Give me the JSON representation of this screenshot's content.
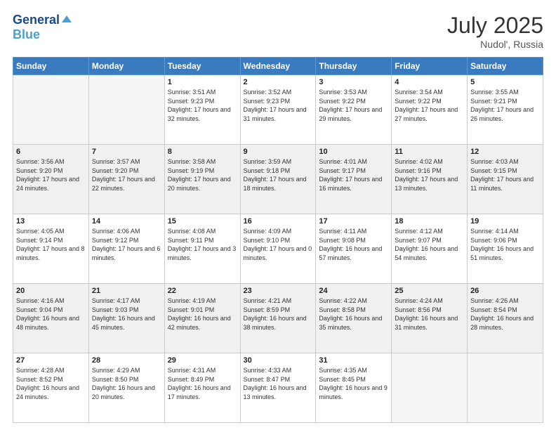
{
  "header": {
    "logo_line1": "General",
    "logo_line2": "Blue",
    "month_year": "July 2025",
    "location": "Nudol', Russia"
  },
  "days_of_week": [
    "Sunday",
    "Monday",
    "Tuesday",
    "Wednesday",
    "Thursday",
    "Friday",
    "Saturday"
  ],
  "weeks": [
    [
      {
        "day": "",
        "sunrise": "",
        "sunset": "",
        "daylight": "",
        "empty": true
      },
      {
        "day": "",
        "sunrise": "",
        "sunset": "",
        "daylight": "",
        "empty": true
      },
      {
        "day": "1",
        "sunrise": "Sunrise: 3:51 AM",
        "sunset": "Sunset: 9:23 PM",
        "daylight": "Daylight: 17 hours and 32 minutes.",
        "empty": false
      },
      {
        "day": "2",
        "sunrise": "Sunrise: 3:52 AM",
        "sunset": "Sunset: 9:23 PM",
        "daylight": "Daylight: 17 hours and 31 minutes.",
        "empty": false
      },
      {
        "day": "3",
        "sunrise": "Sunrise: 3:53 AM",
        "sunset": "Sunset: 9:22 PM",
        "daylight": "Daylight: 17 hours and 29 minutes.",
        "empty": false
      },
      {
        "day": "4",
        "sunrise": "Sunrise: 3:54 AM",
        "sunset": "Sunset: 9:22 PM",
        "daylight": "Daylight: 17 hours and 27 minutes.",
        "empty": false
      },
      {
        "day": "5",
        "sunrise": "Sunrise: 3:55 AM",
        "sunset": "Sunset: 9:21 PM",
        "daylight": "Daylight: 17 hours and 26 minutes.",
        "empty": false
      }
    ],
    [
      {
        "day": "6",
        "sunrise": "Sunrise: 3:56 AM",
        "sunset": "Sunset: 9:20 PM",
        "daylight": "Daylight: 17 hours and 24 minutes.",
        "empty": false
      },
      {
        "day": "7",
        "sunrise": "Sunrise: 3:57 AM",
        "sunset": "Sunset: 9:20 PM",
        "daylight": "Daylight: 17 hours and 22 minutes.",
        "empty": false
      },
      {
        "day": "8",
        "sunrise": "Sunrise: 3:58 AM",
        "sunset": "Sunset: 9:19 PM",
        "daylight": "Daylight: 17 hours and 20 minutes.",
        "empty": false
      },
      {
        "day": "9",
        "sunrise": "Sunrise: 3:59 AM",
        "sunset": "Sunset: 9:18 PM",
        "daylight": "Daylight: 17 hours and 18 minutes.",
        "empty": false
      },
      {
        "day": "10",
        "sunrise": "Sunrise: 4:01 AM",
        "sunset": "Sunset: 9:17 PM",
        "daylight": "Daylight: 17 hours and 16 minutes.",
        "empty": false
      },
      {
        "day": "11",
        "sunrise": "Sunrise: 4:02 AM",
        "sunset": "Sunset: 9:16 PM",
        "daylight": "Daylight: 17 hours and 13 minutes.",
        "empty": false
      },
      {
        "day": "12",
        "sunrise": "Sunrise: 4:03 AM",
        "sunset": "Sunset: 9:15 PM",
        "daylight": "Daylight: 17 hours and 11 minutes.",
        "empty": false
      }
    ],
    [
      {
        "day": "13",
        "sunrise": "Sunrise: 4:05 AM",
        "sunset": "Sunset: 9:14 PM",
        "daylight": "Daylight: 17 hours and 8 minutes.",
        "empty": false
      },
      {
        "day": "14",
        "sunrise": "Sunrise: 4:06 AM",
        "sunset": "Sunset: 9:12 PM",
        "daylight": "Daylight: 17 hours and 6 minutes.",
        "empty": false
      },
      {
        "day": "15",
        "sunrise": "Sunrise: 4:08 AM",
        "sunset": "Sunset: 9:11 PM",
        "daylight": "Daylight: 17 hours and 3 minutes.",
        "empty": false
      },
      {
        "day": "16",
        "sunrise": "Sunrise: 4:09 AM",
        "sunset": "Sunset: 9:10 PM",
        "daylight": "Daylight: 17 hours and 0 minutes.",
        "empty": false
      },
      {
        "day": "17",
        "sunrise": "Sunrise: 4:11 AM",
        "sunset": "Sunset: 9:08 PM",
        "daylight": "Daylight: 16 hours and 57 minutes.",
        "empty": false
      },
      {
        "day": "18",
        "sunrise": "Sunrise: 4:12 AM",
        "sunset": "Sunset: 9:07 PM",
        "daylight": "Daylight: 16 hours and 54 minutes.",
        "empty": false
      },
      {
        "day": "19",
        "sunrise": "Sunrise: 4:14 AM",
        "sunset": "Sunset: 9:06 PM",
        "daylight": "Daylight: 16 hours and 51 minutes.",
        "empty": false
      }
    ],
    [
      {
        "day": "20",
        "sunrise": "Sunrise: 4:16 AM",
        "sunset": "Sunset: 9:04 PM",
        "daylight": "Daylight: 16 hours and 48 minutes.",
        "empty": false
      },
      {
        "day": "21",
        "sunrise": "Sunrise: 4:17 AM",
        "sunset": "Sunset: 9:03 PM",
        "daylight": "Daylight: 16 hours and 45 minutes.",
        "empty": false
      },
      {
        "day": "22",
        "sunrise": "Sunrise: 4:19 AM",
        "sunset": "Sunset: 9:01 PM",
        "daylight": "Daylight: 16 hours and 42 minutes.",
        "empty": false
      },
      {
        "day": "23",
        "sunrise": "Sunrise: 4:21 AM",
        "sunset": "Sunset: 8:59 PM",
        "daylight": "Daylight: 16 hours and 38 minutes.",
        "empty": false
      },
      {
        "day": "24",
        "sunrise": "Sunrise: 4:22 AM",
        "sunset": "Sunset: 8:58 PM",
        "daylight": "Daylight: 16 hours and 35 minutes.",
        "empty": false
      },
      {
        "day": "25",
        "sunrise": "Sunrise: 4:24 AM",
        "sunset": "Sunset: 8:56 PM",
        "daylight": "Daylight: 16 hours and 31 minutes.",
        "empty": false
      },
      {
        "day": "26",
        "sunrise": "Sunrise: 4:26 AM",
        "sunset": "Sunset: 8:54 PM",
        "daylight": "Daylight: 16 hours and 28 minutes.",
        "empty": false
      }
    ],
    [
      {
        "day": "27",
        "sunrise": "Sunrise: 4:28 AM",
        "sunset": "Sunset: 8:52 PM",
        "daylight": "Daylight: 16 hours and 24 minutes.",
        "empty": false
      },
      {
        "day": "28",
        "sunrise": "Sunrise: 4:29 AM",
        "sunset": "Sunset: 8:50 PM",
        "daylight": "Daylight: 16 hours and 20 minutes.",
        "empty": false
      },
      {
        "day": "29",
        "sunrise": "Sunrise: 4:31 AM",
        "sunset": "Sunset: 8:49 PM",
        "daylight": "Daylight: 16 hours and 17 minutes.",
        "empty": false
      },
      {
        "day": "30",
        "sunrise": "Sunrise: 4:33 AM",
        "sunset": "Sunset: 8:47 PM",
        "daylight": "Daylight: 16 hours and 13 minutes.",
        "empty": false
      },
      {
        "day": "31",
        "sunrise": "Sunrise: 4:35 AM",
        "sunset": "Sunset: 8:45 PM",
        "daylight": "Daylight: 16 hours and 9 minutes.",
        "empty": false
      },
      {
        "day": "",
        "sunrise": "",
        "sunset": "",
        "daylight": "",
        "empty": true
      },
      {
        "day": "",
        "sunrise": "",
        "sunset": "",
        "daylight": "",
        "empty": true
      }
    ]
  ]
}
